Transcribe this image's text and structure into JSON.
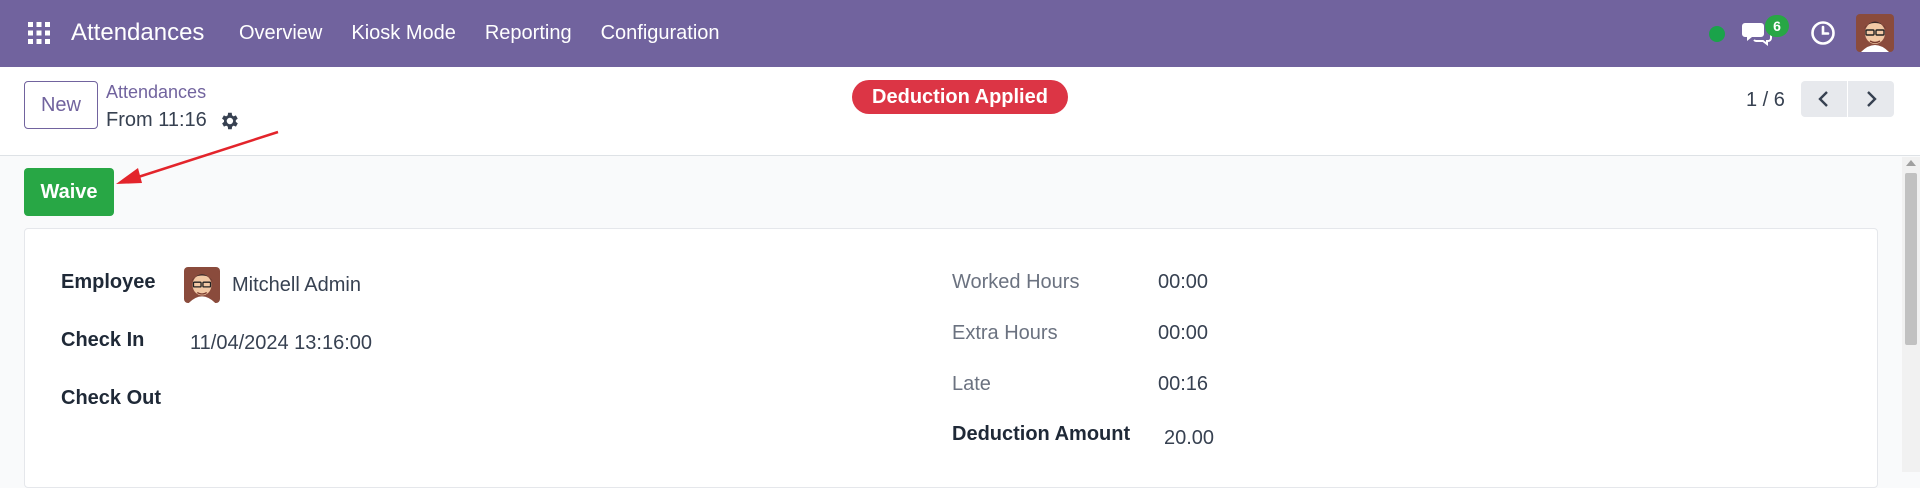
{
  "navbar": {
    "app_title": "Attendances",
    "menu": [
      "Overview",
      "Kiosk Mode",
      "Reporting",
      "Configuration"
    ],
    "chat_count": "6",
    "icons": [
      "apps-grid-icon",
      "presence-status-icon",
      "chat-icon",
      "clock-icon",
      "user-avatar"
    ],
    "colors": {
      "bar": "#71639e",
      "presence": "#1aa34a",
      "badge": "#28a745"
    }
  },
  "control_panel": {
    "new_label": "New",
    "breadcrumb": "Attendances",
    "record_name": "From 11:16",
    "status_badge": "Deduction Applied",
    "pager": "1 / 6",
    "colors": {
      "status_badge": "#dc3545"
    }
  },
  "actions": {
    "waive_label": "Waive",
    "colors": {
      "waive": "#28a745",
      "annotation_arrow": "#e3242b"
    }
  },
  "form": {
    "left": {
      "employee_label": "Employee",
      "employee_value": "Mitchell Admin",
      "check_in_label": "Check In",
      "check_in_value": "11/04/2024 13:16:00",
      "check_out_label": "Check Out",
      "check_out_value": ""
    },
    "right": {
      "worked_hours_label": "Worked Hours",
      "worked_hours_value": "00:00",
      "extra_hours_label": "Extra Hours",
      "extra_hours_value": "00:00",
      "late_label": "Late",
      "late_value": "00:16",
      "deduction_label": "Deduction Amount",
      "deduction_value": "20.00"
    }
  }
}
